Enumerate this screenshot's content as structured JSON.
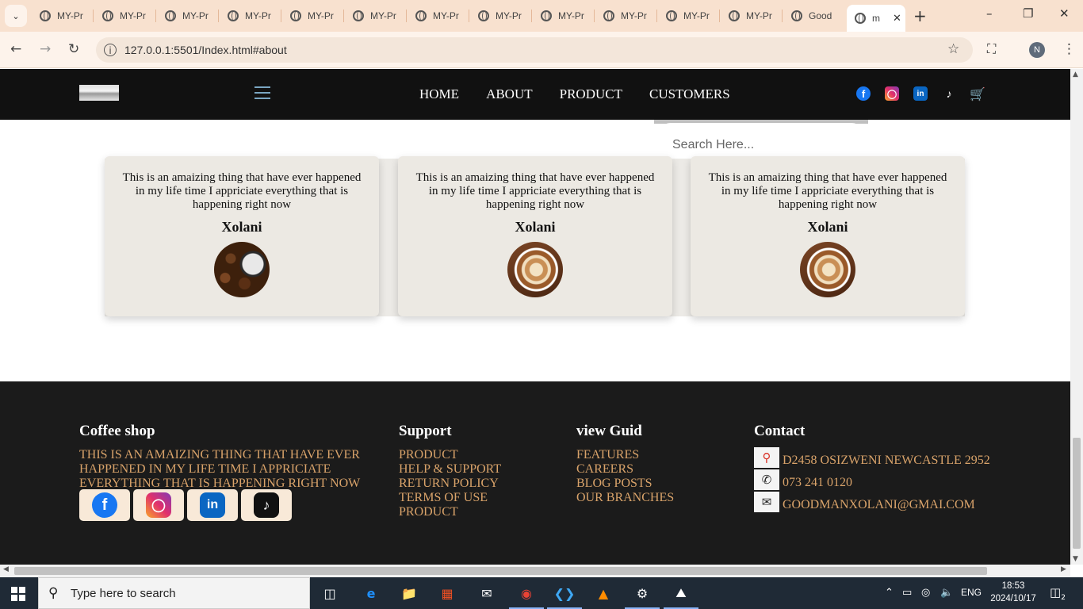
{
  "browser": {
    "tabs": [
      {
        "title": "MY-Pr"
      },
      {
        "title": "MY-Pr"
      },
      {
        "title": "MY-Pr"
      },
      {
        "title": "MY-Pr"
      },
      {
        "title": "MY-Pr"
      },
      {
        "title": "MY-Pr"
      },
      {
        "title": "MY-Pr"
      },
      {
        "title": "MY-Pr"
      },
      {
        "title": "MY-Pr"
      },
      {
        "title": "MY-Pr"
      },
      {
        "title": "MY-Pr"
      },
      {
        "title": "MY-Pr"
      },
      {
        "title": "Good"
      }
    ],
    "active_tab": {
      "title": "m"
    },
    "url": "127.0.0.1:5501/Index.html#about",
    "profile_initial": "N"
  },
  "site": {
    "nav": [
      "HOME",
      "ABOUT",
      "PRODUCT",
      "CUSTOMERS"
    ],
    "social_icons": [
      "facebook-icon",
      "instagram-icon",
      "linkedin-icon",
      "tiktok-icon",
      "cart-icon"
    ],
    "search_placeholder": "Search Here..."
  },
  "testimonials": [
    {
      "text": "This is an amaizing thing that have ever happened in my life time I appriciate everything that is happening right now",
      "name": "Xolani",
      "image": "coffee-beans"
    },
    {
      "text": "This is an amaizing thing that have ever happened in my life time I appriciate everything that is happening right now",
      "name": "Xolani",
      "image": "latte-art"
    },
    {
      "text": "This is an amaizing thing that have ever happened in my life time I appriciate everything that is happening right now",
      "name": "Xolani",
      "image": "latte-art"
    }
  ],
  "footer": {
    "about": {
      "title": "Coffee shop",
      "text": "THIS IS AN AMAIZING THING THAT HAVE EVER HAPPENED IN MY LIFE TIME I APPRICIATE EVERYTHING THAT IS HAPPENING RIGHT NOW"
    },
    "support": {
      "title": "Support",
      "links": [
        "PRODUCT",
        "HELP & SUPPORT",
        "RETURN POLICY",
        "TERMS OF USE",
        "PRODUCT"
      ]
    },
    "guide": {
      "title": "view Guid",
      "links": [
        "FEATURES",
        "CAREERS",
        "BLOG POSTS",
        "OUR BRANCHES"
      ]
    },
    "contact": {
      "title": "Contact",
      "address": "D2458 OSIZWENI NEWCASTLE 2952",
      "phone": "073 241 0120",
      "email": "GOODMANXOLANI@GMAI.COM"
    }
  },
  "taskbar": {
    "search_placeholder": "Type here to search",
    "language": "ENG",
    "time": "18:53",
    "date": "2024/10/17",
    "notification_count": "2"
  },
  "colors": {
    "header_bg": "#111111",
    "footer_bg": "#1b1b1b",
    "footer_link": "#d9a36a",
    "card_bg": "#ece9e3",
    "tab_strip": "#f8e1cf"
  }
}
